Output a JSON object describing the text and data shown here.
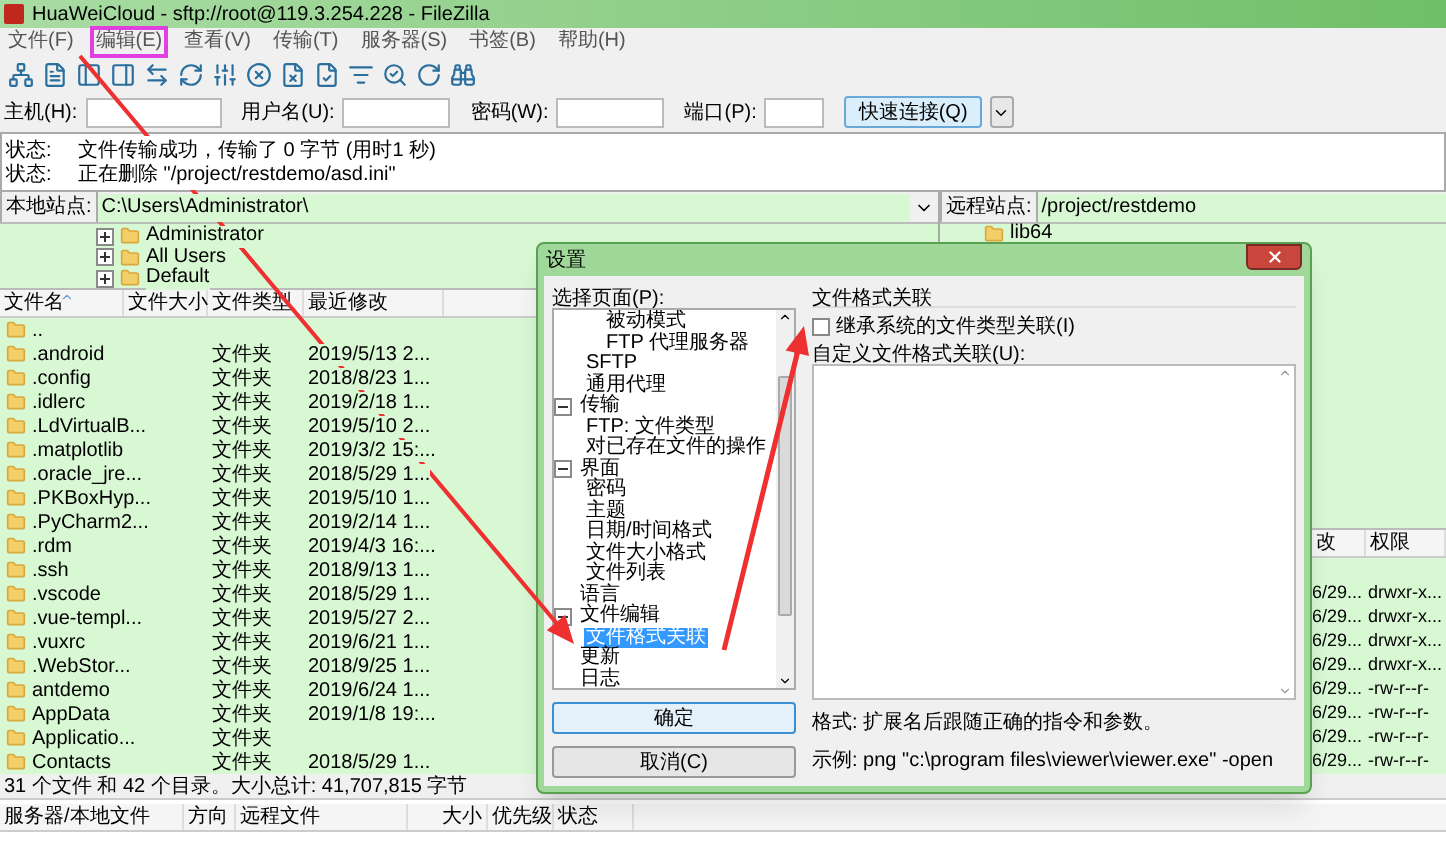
{
  "window": {
    "title": "HuaWeiCloud - sftp://root@119.3.254.228 - FileZilla"
  },
  "menu": [
    {
      "label": "文件(F)",
      "highlighted": false
    },
    {
      "label": "编辑(E)",
      "highlighted": true
    },
    {
      "label": "查看(V)",
      "highlighted": false
    },
    {
      "label": "传输(T)",
      "highlighted": false
    },
    {
      "label": "服务器(S)",
      "highlighted": false
    },
    {
      "label": "书签(B)",
      "highlighted": false
    },
    {
      "label": "帮助(H)",
      "highlighted": false
    }
  ],
  "quickconnect": {
    "host_label": "主机(H):",
    "user_label": "用户名(U):",
    "password_label": "密码(W):",
    "port_label": "端口(P):",
    "button": "快速连接(Q)"
  },
  "log": [
    {
      "label": "状态:",
      "message": "文件传输成功，传输了 0 字节 (用时1 秒)"
    },
    {
      "label": "状态:",
      "message": "正在删除 \"/project/restdemo/asd.ini\""
    }
  ],
  "local": {
    "site_label": "本地站点:",
    "path": "C:\\Users\\Administrator\\",
    "tree": [
      {
        "label": "Administrator",
        "expanded": false
      },
      {
        "label": "All Users",
        "expanded": false
      },
      {
        "label": "Default",
        "expanded": false
      }
    ],
    "columns": [
      "文件名",
      "文件大小",
      "文件类型",
      "最近修改"
    ],
    "rows": [
      {
        "name": ".."
      },
      {
        "name": ".android",
        "type": "文件夹",
        "modified": "2019/5/13 2..."
      },
      {
        "name": ".config",
        "type": "文件夹",
        "modified": "2018/8/23 1..."
      },
      {
        "name": ".idlerc",
        "type": "文件夹",
        "modified": "2019/2/18 1..."
      },
      {
        "name": ".LdVirtualB...",
        "type": "文件夹",
        "modified": "2019/5/10 2..."
      },
      {
        "name": ".matplotlib",
        "type": "文件夹",
        "modified": "2019/3/2 15:..."
      },
      {
        "name": ".oracle_jre...",
        "type": "文件夹",
        "modified": "2018/5/29 1..."
      },
      {
        "name": ".PKBoxHyp...",
        "type": "文件夹",
        "modified": "2019/5/10 1..."
      },
      {
        "name": ".PyCharm2...",
        "type": "文件夹",
        "modified": "2019/2/14 1..."
      },
      {
        "name": ".rdm",
        "type": "文件夹",
        "modified": "2019/4/3 16:..."
      },
      {
        "name": ".ssh",
        "type": "文件夹",
        "modified": "2018/9/13 1..."
      },
      {
        "name": ".vscode",
        "type": "文件夹",
        "modified": "2018/5/29 1..."
      },
      {
        "name": ".vue-templ...",
        "type": "文件夹",
        "modified": "2019/5/27 2..."
      },
      {
        "name": ".vuxrc",
        "type": "文件夹",
        "modified": "2019/6/21 1..."
      },
      {
        "name": ".WebStor...",
        "type": "文件夹",
        "modified": "2018/9/25 1..."
      },
      {
        "name": "antdemo",
        "type": "文件夹",
        "modified": "2019/6/24 1..."
      },
      {
        "name": "AppData",
        "type": "文件夹",
        "modified": "2019/1/8 19:..."
      },
      {
        "name": "Applicatio...",
        "type": "文件夹"
      },
      {
        "name": "Contacts",
        "type": "文件夹",
        "modified": "2018/5/29 1..."
      }
    ],
    "status": "31 个文件 和 42 个目录。大小总计: 41,707,815 字节"
  },
  "remote": {
    "site_label": "远程站点:",
    "path": "/project/restdemo",
    "tree": [
      {
        "label": "lib64"
      }
    ],
    "columns": [
      "改",
      "权限"
    ],
    "rows": [
      {
        "modified": "6/29...",
        "permissions": "drwxr-x..."
      },
      {
        "modified": "6/29...",
        "permissions": "drwxr-x..."
      },
      {
        "modified": "6/29...",
        "permissions": "drwxr-x..."
      },
      {
        "modified": "6/29...",
        "permissions": "drwxr-x..."
      },
      {
        "modified": "6/29...",
        "permissions": "-rw-r--r-"
      },
      {
        "modified": "6/29...",
        "permissions": "-rw-r--r-"
      },
      {
        "modified": "6/29...",
        "permissions": "-rw-r--r-"
      },
      {
        "modified": "6/29...",
        "permissions": "-rw-r--r-"
      }
    ]
  },
  "queue": {
    "columns": [
      "服务器/本地文件",
      "方向",
      "远程文件",
      "大小",
      "优先级",
      "状态"
    ]
  },
  "dialog": {
    "title": "设置",
    "pages_label": "选择页面(P):",
    "pages": [
      {
        "children": [
          {
            "children": [
              {
                "label": "被动模式",
                "selected": false
              },
              {
                "label": "FTP 代理服务器",
                "selected": false
              }
            ]
          },
          {
            "label": "SFTP",
            "selected": false
          },
          {
            "label": "通用代理",
            "selected": false
          }
        ]
      },
      {
        "label": "传输",
        "selected": false,
        "expanded": true,
        "children": [
          {
            "label": "FTP: 文件类型",
            "selected": false
          },
          {
            "label": "对已存在文件的操作",
            "selected": false
          }
        ]
      },
      {
        "label": "界面",
        "selected": false,
        "expanded": true,
        "children": [
          {
            "label": "密码",
            "selected": false
          },
          {
            "label": "主题",
            "selected": false
          },
          {
            "label": "日期/时间格式",
            "selected": false
          },
          {
            "label": "文件大小格式",
            "selected": false
          },
          {
            "label": "文件列表",
            "selected": false
          }
        ]
      },
      {
        "label": "语言",
        "selected": false
      },
      {
        "label": "文件编辑",
        "selected": false,
        "expanded": true,
        "children": [
          {
            "label": "文件格式关联",
            "selected": true
          }
        ]
      },
      {
        "label": "更新",
        "selected": false
      },
      {
        "label": "日志",
        "selected": false
      }
    ],
    "ok": "确定",
    "cancel": "取消(C)",
    "section_title": "文件格式关联",
    "inherit_checkbox": {
      "label": "继承系统的文件类型关联(I)",
      "checked": false
    },
    "custom_label": "自定义文件格式关联(U):",
    "format_hint": "格式: 扩展名后跟随正确的指令和参数。",
    "example": "示例: png \"c:\\program files\\viewer\\viewer.exe\" -open"
  }
}
